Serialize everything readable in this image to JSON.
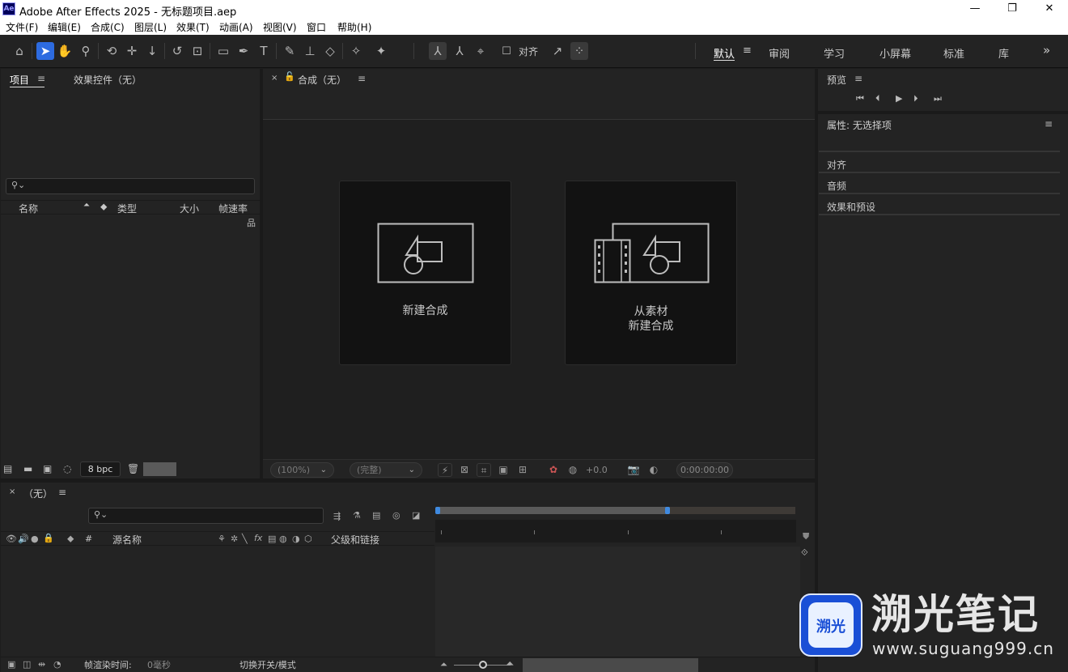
{
  "window": {
    "app_icon_text": "Ae",
    "title": "Adobe After Effects 2025 - 无标题项目.aep",
    "minimize": "—",
    "restore": "❐",
    "close": "✕"
  },
  "menu": [
    "文件(F)",
    "编辑(E)",
    "合成(C)",
    "图层(L)",
    "效果(T)",
    "动画(A)",
    "视图(V)",
    "窗口",
    "帮助(H)"
  ],
  "toolbar": {
    "align_label": "对齐",
    "workspaces": [
      "默认",
      "审阅",
      "学习",
      "小屏幕",
      "标准",
      "库"
    ],
    "overflow": "»"
  },
  "project_panel": {
    "tab_project": "项目",
    "tab_effects": "效果控件（无）",
    "columns": [
      "名称",
      "类型",
      "大小",
      "帧速率"
    ],
    "bpc": "8 bpc"
  },
  "composition_panel": {
    "tab_label": "合成（无）",
    "card_new_comp": "新建合成",
    "card_from_footage_line1": "从素材",
    "card_from_footage_line2": "新建合成",
    "zoom": "(100%)",
    "resolution": "(完整)",
    "exposure": "+0.0",
    "timecode": "0:00:00:00"
  },
  "right_panel": {
    "preview_label": "预览",
    "properties_label": "属性: 无选择项",
    "sections": [
      "对齐",
      "音频",
      "效果和预设"
    ]
  },
  "timeline": {
    "tab_label": "（无）",
    "source_name": "源名称",
    "parent_link": "父级和链接",
    "number_col": "#",
    "render_time_label": "帧渲染时间:",
    "render_time_value": "0毫秒",
    "toggle_modes": "切换开关/模式"
  },
  "watermark": {
    "logo_text": "溯光",
    "title": "溯光笔记",
    "url": "www.suguang999.cn"
  },
  "colors": {
    "accent": "#2d6be0",
    "panel_bg": "#232323",
    "frame_bg": "#1d1d1d",
    "work_area": "#5a5a5a",
    "playhead": "#3f8ae0"
  }
}
